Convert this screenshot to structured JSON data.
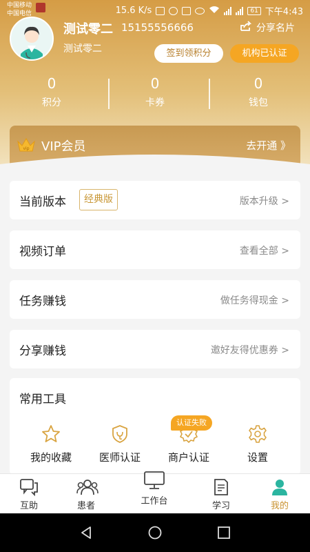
{
  "status_bar": {
    "carrier1": "中国移动",
    "carrier2": "中国电信",
    "speed": "15.6 K/s",
    "battery": "61",
    "time": "下午4:43"
  },
  "profile": {
    "name": "测试零二",
    "phone": "15155556666",
    "subname": "测试零二",
    "share_label": "分享名片",
    "checkin_label": "签到领积分",
    "certified_label": "机构已认证"
  },
  "stats": [
    {
      "value": "0",
      "label": "积分"
    },
    {
      "value": "0",
      "label": "卡券"
    },
    {
      "value": "0",
      "label": "钱包"
    }
  ],
  "vip": {
    "badge": "vip",
    "title": "VIP会员",
    "link": "去开通 》"
  },
  "menu": {
    "version": {
      "title": "当前版本",
      "tag": "经典版",
      "link": "版本升级 >"
    },
    "video_orders": {
      "title": "视频订单",
      "link": "查看全部 >"
    },
    "tasks": {
      "title": "任务赚钱",
      "link": "做任务得现金 >"
    },
    "share": {
      "title": "分享赚钱",
      "link": "邀好友得优惠券 >"
    }
  },
  "tools": {
    "title": "常用工具",
    "fail_badge": "认证失败",
    "items": [
      {
        "label": "我的收藏",
        "icon": "star-icon"
      },
      {
        "label": "医师认证",
        "icon": "doctor-shield-icon"
      },
      {
        "label": "商户认证",
        "icon": "merchant-check-icon"
      },
      {
        "label": "设置",
        "icon": "gear-icon"
      }
    ]
  },
  "tabbar": [
    {
      "label": "互助",
      "icon": "chat-icon"
    },
    {
      "label": "患者",
      "icon": "patients-icon"
    },
    {
      "label": "工作台",
      "icon": "monitor-icon"
    },
    {
      "label": "学习",
      "icon": "document-icon"
    },
    {
      "label": "我的",
      "icon": "person-icon",
      "active": true
    }
  ],
  "colors": {
    "accent": "#f5a623",
    "gold": "#c9922f",
    "header_top": "#d59c45",
    "header_bottom": "#f2e2bd"
  }
}
